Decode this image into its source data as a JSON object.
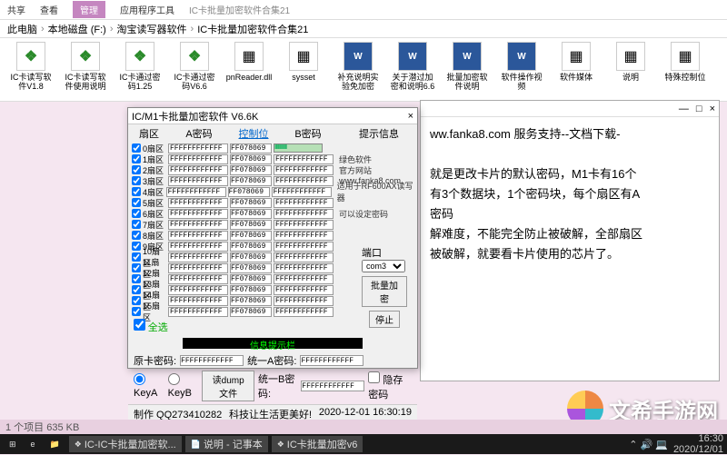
{
  "ribbon": {
    "tabs": [
      "共享",
      "查看"
    ],
    "purple_tab": "管理",
    "group": "应用程序工具",
    "title": "IC卡批量加密软件合集21"
  },
  "breadcrumb": [
    "此电脑",
    "本地磁盘 (F:)",
    "淘宝读写器软件",
    "IC卡批量加密软件合集21"
  ],
  "files": [
    {
      "type": "clover",
      "label": "IC卡读写软件V1.8"
    },
    {
      "type": "clover",
      "label": "IC卡读写软件使用说明"
    },
    {
      "type": "clover",
      "label": "IC卡通过密码1.25"
    },
    {
      "type": "clover",
      "label": "IC卡通过密码V6.6"
    },
    {
      "type": "file",
      "label": "pnReader.dll"
    },
    {
      "type": "file",
      "label": "sysset"
    },
    {
      "type": "word",
      "label": "补充说明实验免加密"
    },
    {
      "type": "word",
      "label": "关于潜过加密和说明6.6"
    },
    {
      "type": "word",
      "label": "批量加密软件说明"
    },
    {
      "type": "word",
      "label": "软件操作视频"
    },
    {
      "type": "file",
      "label": "软件媒体"
    },
    {
      "type": "file",
      "label": "说明"
    },
    {
      "type": "file",
      "label": "特殊控制位"
    }
  ],
  "dialog": {
    "title": "IC/M1卡批量加密软件 V6.6K",
    "headers": {
      "sector": "扇区",
      "keyA": "A密码",
      "ctrl": "控制位",
      "keyB": "B密码",
      "info": "提示信息"
    },
    "rows": [
      {
        "sec": "0扇区",
        "a": "FFFFFFFFFFFF",
        "c": "FF078069",
        "b": "FFFFFFFFFFFF",
        "info": ""
      },
      {
        "sec": "1扇区",
        "a": "FFFFFFFFFFFF",
        "c": "FF078069",
        "b": "FFFFFFFFFFFF",
        "info": "绿色软件"
      },
      {
        "sec": "2扇区",
        "a": "FFFFFFFFFFFF",
        "c": "FF078069",
        "b": "FFFFFFFFFFFF",
        "info": "官方网站"
      },
      {
        "sec": "3扇区",
        "a": "FFFFFFFFFFFF",
        "c": "FF078069",
        "b": "FFFFFFFFFFFF",
        "info": "www.fanka8.com"
      },
      {
        "sec": "4扇区",
        "a": "FFFFFFFFFFFF",
        "c": "FF078069",
        "b": "FFFFFFFFFFFF",
        "info": "适用于RF600AX读写器"
      },
      {
        "sec": "5扇区",
        "a": "FFFFFFFFFFFF",
        "c": "FF078069",
        "b": "FFFFFFFFFFFF",
        "info": ""
      },
      {
        "sec": "6扇区",
        "a": "FFFFFFFFFFFF",
        "c": "FF078069",
        "b": "FFFFFFFFFFFF",
        "info": "可以设定密码"
      },
      {
        "sec": "7扇区",
        "a": "FFFFFFFFFFFF",
        "c": "FF078069",
        "b": "FFFFFFFFFFFF",
        "info": ""
      },
      {
        "sec": "8扇区",
        "a": "FFFFFFFFFFFF",
        "c": "FF078069",
        "b": "FFFFFFFFFFFF",
        "info": ""
      },
      {
        "sec": "9扇区",
        "a": "FFFFFFFFFFFF",
        "c": "FF078069",
        "b": "FFFFFFFFFFFF",
        "info": ""
      },
      {
        "sec": "10扇区",
        "a": "FFFFFFFFFFFF",
        "c": "FF078069",
        "b": "FFFFFFFFFFFF",
        "info": ""
      },
      {
        "sec": "11扇区",
        "a": "FFFFFFFFFFFF",
        "c": "FF078069",
        "b": "FFFFFFFFFFFF",
        "info": ""
      },
      {
        "sec": "12扇区",
        "a": "FFFFFFFFFFFF",
        "c": "FF078069",
        "b": "FFFFFFFFFFFF",
        "info": ""
      },
      {
        "sec": "13扇区",
        "a": "FFFFFFFFFFFF",
        "c": "FF078069",
        "b": "FFFFFFFFFFFF",
        "info": ""
      },
      {
        "sec": "14扇区",
        "a": "FFFFFFFFFFFF",
        "c": "FF078069",
        "b": "FFFFFFFFFFFF",
        "info": ""
      },
      {
        "sec": "15扇区",
        "a": "FFFFFFFFFFFF",
        "c": "FF078069",
        "b": "FFFFFFFFFFFF",
        "info": ""
      }
    ],
    "all_select": "全选",
    "info_bar": "信息提示栏",
    "port_label": "端口",
    "port_value": "com3",
    "btn_batch": "批量加密",
    "btn_stop": "停止",
    "orig_pass": "原卡密码:",
    "orig_val": "FFFFFFFFFFFF",
    "unify_a": "统一A密码:",
    "unify_a_val": "FFFFFFFFFFFF",
    "unify_b": "统一B密码:",
    "unify_b_val": "FFFFFFFFFFFF",
    "keyA": "KeyA",
    "keyB": "KeyB",
    "dump": "读dump文件",
    "hide": "隐存密码",
    "status_left": "制作 QQ273410282",
    "status_mid": "科技让生活更美好!",
    "status_right": "2020-12-01 16:30:19"
  },
  "notepad": {
    "lines": [
      "ww.fanka8.com 服务支持--文档下载-",
      "",
      "就是更改卡片的默认密码，M1卡有16个",
      "有3个数据块，1个密码块，每个扇区有A",
      "密码",
      "解难度，不能完全防止被破解，全部扇区",
      "被破解，就要看卡片使用的芯片了。"
    ]
  },
  "watermark": "文希手游网",
  "statusbar": "1 个项目  635 KB",
  "taskbar": {
    "items": [
      "IC-IC卡批量加密软...",
      "说明 - 记事本",
      "IC卡批量加密v6"
    ],
    "time": "16:30",
    "date": "2020/12/01"
  }
}
